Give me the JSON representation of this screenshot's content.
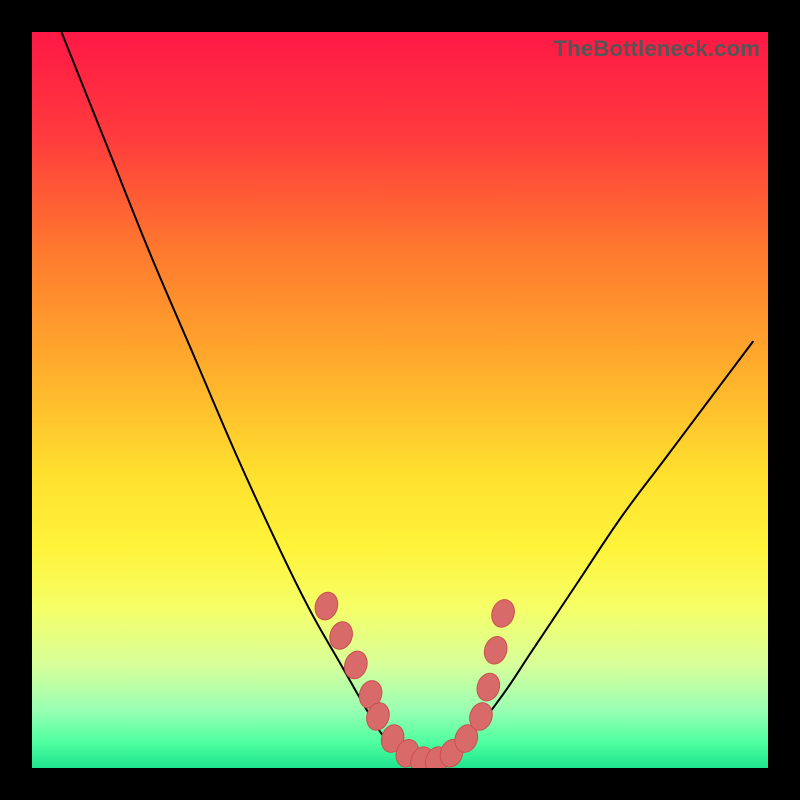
{
  "watermark": "TheBottleneck.com",
  "colors": {
    "frame": "#000000",
    "curve_stroke": "#000000",
    "marker_fill": "#d96a6a",
    "marker_stroke": "#c94f4f",
    "gradient_stops": [
      {
        "offset": 0,
        "color": "#ff1846"
      },
      {
        "offset": 0.14,
        "color": "#ff3a3d"
      },
      {
        "offset": 0.3,
        "color": "#ff7a2e"
      },
      {
        "offset": 0.46,
        "color": "#ffae2c"
      },
      {
        "offset": 0.6,
        "color": "#ffe02e"
      },
      {
        "offset": 0.7,
        "color": "#fff33a"
      },
      {
        "offset": 0.78,
        "color": "#f6ff66"
      },
      {
        "offset": 0.86,
        "color": "#d7ff9a"
      },
      {
        "offset": 0.92,
        "color": "#9bffb3"
      },
      {
        "offset": 0.965,
        "color": "#4fffa0"
      },
      {
        "offset": 1.0,
        "color": "#1fe58f"
      }
    ]
  },
  "chart_data": {
    "type": "line",
    "title": "",
    "xlabel": "",
    "ylabel": "",
    "xlim": [
      0,
      100
    ],
    "ylim": [
      0,
      100
    ],
    "series": [
      {
        "name": "bottleneck-curve",
        "x": [
          4,
          10,
          16,
          22,
          28,
          34,
          38,
          42,
          46,
          48,
          50,
          52,
          54,
          56,
          60,
          64,
          68,
          74,
          80,
          86,
          92,
          98
        ],
        "values": [
          100,
          85,
          70,
          56,
          42,
          29,
          21,
          14,
          7,
          4,
          2,
          1,
          1,
          2,
          5,
          10,
          16,
          25,
          34,
          42,
          50,
          58
        ]
      }
    ],
    "markers": {
      "name": "bottleneck-markers",
      "x": [
        40,
        42,
        44,
        46,
        47,
        49,
        51,
        53,
        55,
        57,
        59,
        61,
        62,
        63,
        64
      ],
      "values": [
        22,
        18,
        14,
        10,
        7,
        4,
        2,
        1,
        1,
        2,
        4,
        7,
        11,
        16,
        21
      ]
    }
  }
}
